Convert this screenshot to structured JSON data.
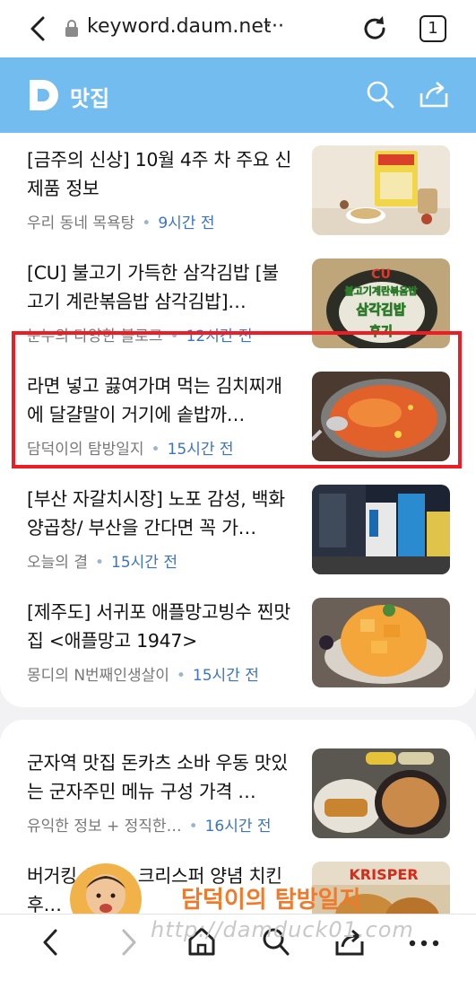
{
  "browser": {
    "url": "keyword.daum.net",
    "more": "···",
    "tab_count": "1"
  },
  "header": {
    "title": "맛집"
  },
  "card1_items": [
    {
      "title": "[금주의 신상] 10월 4주 차 주요 신제품 정보",
      "source": "우리 동네 목욕탕",
      "time": "9시간 전"
    },
    {
      "title": "[CU] 불고기 가득한 삼각김밥 [불고기 계란볶음밥 삼각김밥]…",
      "source": "눈누의 다양한 블로그",
      "time": "12시간 전"
    },
    {
      "title": "라면 넣고 끓여가며 먹는 김치찌개에 달걀말이 거기에 솥밥까…",
      "source": "담덕이의 탐방일지",
      "time": "15시간 전"
    },
    {
      "title": "[부산 자갈치시장] 노포 감성, 백화양곱창/ 부산을 간다면 꼭 가…",
      "source": "오늘의 결",
      "time": "15시간 전"
    },
    {
      "title": "[제주도] 서귀포 애플망고빙수 찐맛집 <애플망고 1947>",
      "source": "몽디의 N번째인생살이",
      "time": "15시간 전"
    }
  ],
  "card2_items": [
    {
      "title": "군자역 맛집 돈카츠 소바 우동 맛있는 군자주민 메뉴 구성 가격 …",
      "source": "유익한 정보 + 정직한…",
      "time": "16시간 전"
    },
    {
      "title": "버거킹 신메뉴 크리스퍼 양념 치킨 후…",
      "source": "",
      "time": ""
    }
  ],
  "thumb_texts": {
    "cu_line1": "CU",
    "cu_line2": "불고기계란볶음밥",
    "cu_line3": "삼각김밥",
    "cu_line4": "후기",
    "krisper": "KRISPER"
  },
  "watermark": {
    "url": "http://damduck01.com",
    "title": "담덕이의 탐방일지"
  },
  "colors": {
    "header_bg": "#72bcef",
    "highlight": "#ee1c24",
    "time_blue": "#3b73c9"
  }
}
